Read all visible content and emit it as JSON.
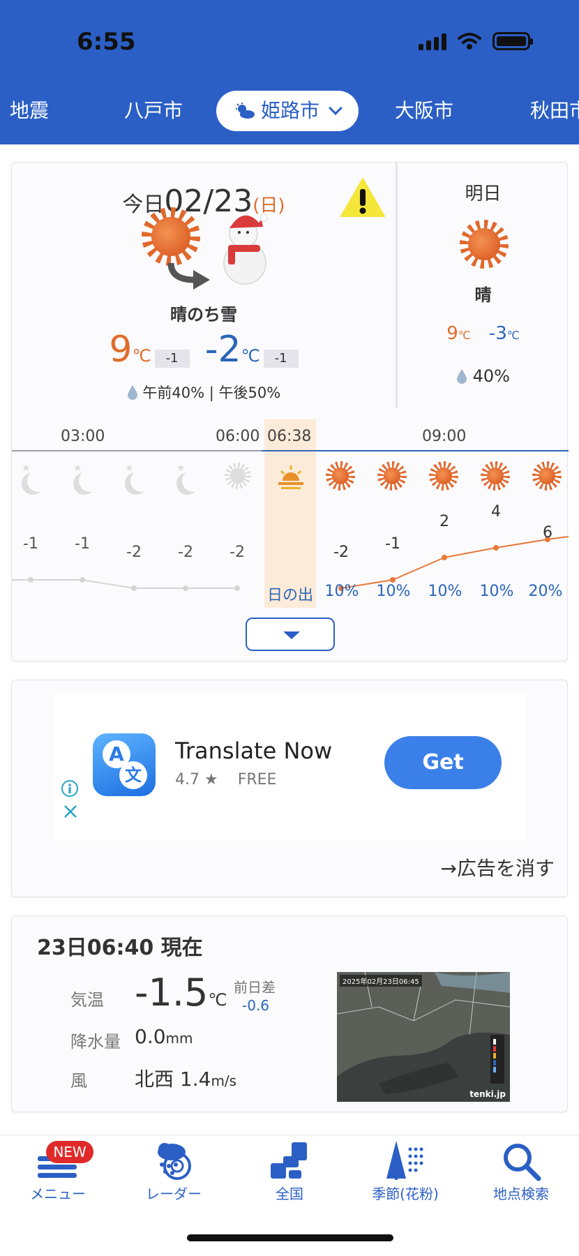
{
  "status_bar": {
    "time": "6:55"
  },
  "city_tabs": {
    "items": [
      "地震",
      "八戸市",
      "姫路市",
      "大阪市",
      "秋田市"
    ],
    "active_index": 2
  },
  "today": {
    "label": "今日",
    "date": "02/23",
    "dow_open": "(",
    "dow": "日",
    "dow_close": ")",
    "weather": "晴のち雪",
    "max_temp": "9",
    "max_diff": "-1",
    "min_temp": "-2",
    "min_diff": "-1",
    "unit": "℃",
    "precip_am": "午前40%",
    "precip_sep": "|",
    "precip_pm": "午後50%"
  },
  "tomorrow": {
    "label": "明日",
    "weather": "晴",
    "max_temp": "9",
    "min_temp": "-3",
    "unit": "℃",
    "precip": "40%"
  },
  "hourly": {
    "time_labels": [
      "03:00",
      "06:00",
      "06:38",
      "09:00"
    ],
    "sunrise_label": "日の出",
    "temps_before": [
      "-1",
      "-1",
      "-2",
      "-2",
      "-2"
    ],
    "temps_after": [
      "-2",
      "-1",
      "2",
      "4",
      "6"
    ],
    "precip": [
      "10%",
      "10%",
      "10%",
      "10%",
      "20%"
    ],
    "colors": {
      "past": "#cccccc",
      "future": "#e8793a",
      "line": "#2b66b8"
    }
  },
  "ad": {
    "app_name": "Translate Now",
    "rating": "4.7 ★",
    "price": "FREE",
    "get_label": "Get",
    "remove_ads": "→広告を消す",
    "icon_letters": [
      "A",
      "文"
    ]
  },
  "observation": {
    "title": "23日06:40 現在",
    "temp_label": "気温",
    "temp_value": "-1.5",
    "temp_unit": "℃",
    "diff_label": "前日差",
    "diff_value": "-0.6",
    "rain_label": "降水量",
    "rain_value": "0.0",
    "rain_unit": "mm",
    "wind_label": "風",
    "wind_value": "北西 1.4",
    "wind_unit": "m/s",
    "radar_timestamp": "2025年02月23日06:45",
    "radar_brand": "tenki.jp"
  },
  "bottom_nav": {
    "badge": "NEW",
    "items": [
      "メニュー",
      "レーダー",
      "全国",
      "季節(花粉)",
      "地点検索"
    ]
  }
}
